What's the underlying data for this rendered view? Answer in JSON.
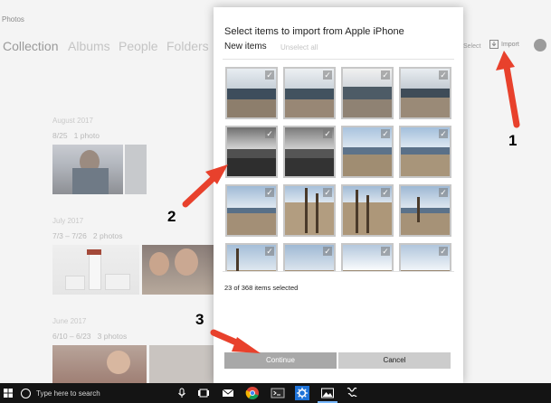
{
  "app": {
    "title": "Photos",
    "nav": [
      "Collection",
      "Albums",
      "People",
      "Folders"
    ],
    "toolbar": {
      "select_label": "Select",
      "import_label": "Import"
    }
  },
  "collection": {
    "groups": [
      {
        "month": "August 2017",
        "range": "8/25",
        "count": "1 photo"
      },
      {
        "month": "July 2017",
        "range": "7/3 – 7/26",
        "count": "2 photos"
      },
      {
        "month": "June 2017",
        "range": "6/10 – 6/23",
        "count": "3 photos"
      }
    ]
  },
  "dialog": {
    "title": "Select items to import from Apple iPhone",
    "new_items_label": "New items",
    "unselect_all_label": "Unselect all",
    "selection_status": "23 of 368 items selected",
    "continue_label": "Continue",
    "cancel_label": "Cancel",
    "thumbnails_checked": true
  },
  "taskbar": {
    "search_placeholder": "Type here to search",
    "icons": [
      "windows-start-icon",
      "cortana-icon",
      "microphone-icon",
      "task-view-icon",
      "mail-icon",
      "chrome-icon",
      "terminal-icon",
      "settings-gear-icon",
      "photos-icon",
      "sketch-app-icon"
    ]
  },
  "annotations": {
    "labels": [
      "1",
      "2",
      "3"
    ],
    "arrow_color": "#e8412c"
  }
}
